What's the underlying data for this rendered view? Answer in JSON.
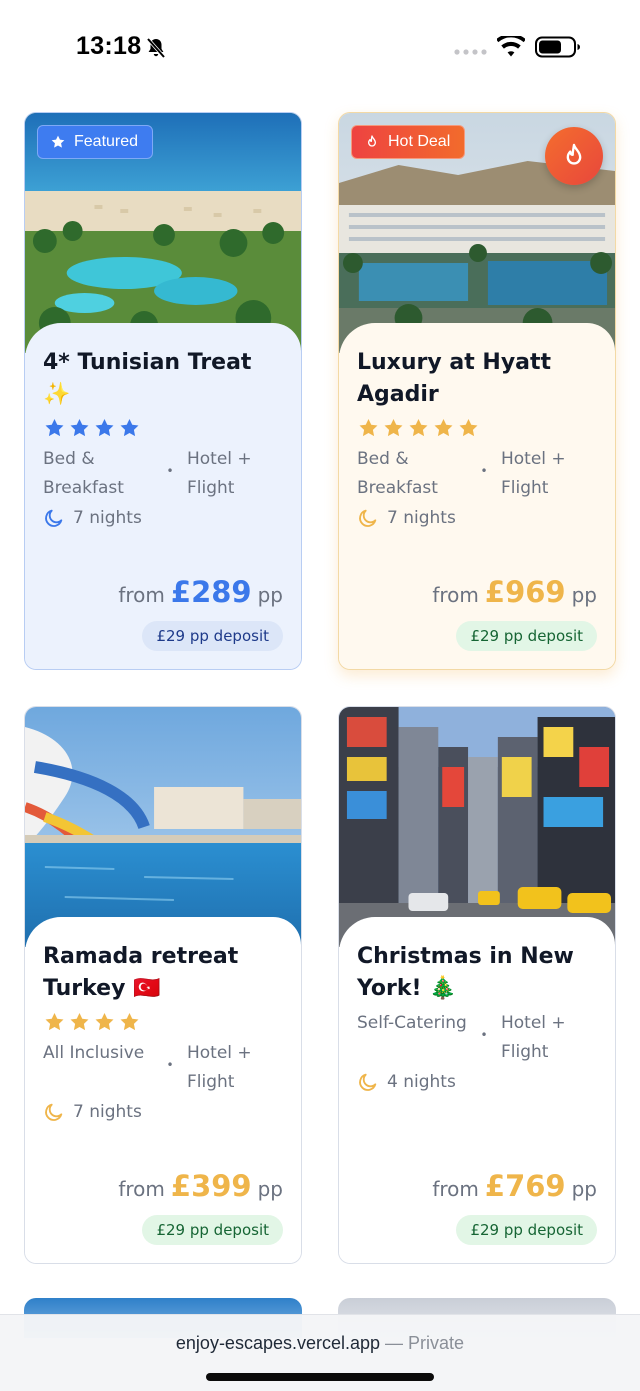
{
  "status_bar": {
    "time": "13:18"
  },
  "cards": [
    {
      "title": "4* Tunisian Treat ✨",
      "badge": "Featured",
      "stars": 4,
      "board": "Bed & Breakfast",
      "package": "Hotel + Flight",
      "nights": "7 nights",
      "from_label": "from",
      "price": "£289",
      "pp_label": "pp",
      "deposit": "£29 pp deposit"
    },
    {
      "title": "Luxury at Hyatt Agadir",
      "badge": "Hot Deal",
      "stars": 5,
      "board": "Bed & Breakfast",
      "package": "Hotel + Flight",
      "nights": "7 nights",
      "from_label": "from",
      "price": "£969",
      "pp_label": "pp",
      "deposit": "£29 pp deposit"
    },
    {
      "title": "Ramada retreat Turkey 🇹🇷",
      "stars": 4,
      "board": "All Inclusive",
      "package": "Hotel + Flight",
      "nights": "7 nights",
      "from_label": "from",
      "price": "£399",
      "pp_label": "pp",
      "deposit": "£29 pp deposit"
    },
    {
      "title": "Christmas in New York! 🎄",
      "stars": 0,
      "board": "Self-Catering",
      "package": "Hotel + Flight",
      "nights": "4 nights",
      "from_label": "from",
      "price": "£769",
      "pp_label": "pp",
      "deposit": "£29 pp deposit"
    }
  ],
  "url_bar": {
    "domain": "enjoy-escapes.vercel.app",
    "separator": " — ",
    "mode": "Private"
  },
  "colors": {
    "featured_blue": "#3b78ea",
    "hot_red": "#ee4341",
    "price_gold": "#efb54a",
    "deposit_green": "#e2f6e6"
  },
  "icons": [
    "bell-slash-icon",
    "wifi-icon",
    "battery-icon",
    "star-icon",
    "flame-icon",
    "moon-icon"
  ]
}
